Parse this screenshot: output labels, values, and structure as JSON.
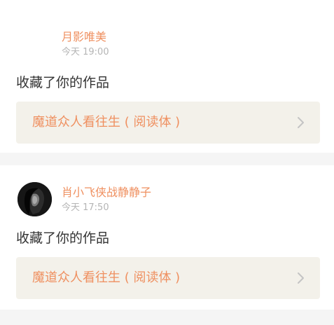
{
  "notifications": [
    {
      "username": "月影唯美",
      "time": "今天 19:00",
      "action": "收藏了你的作品",
      "work_title": "魔道众人看往生 ( 阅读体 )"
    },
    {
      "username": "肖小飞侠战静静子",
      "time": "今天 17:50",
      "action": "收藏了你的作品",
      "work_title": "魔道众人看往生 ( 阅读体 )"
    }
  ],
  "icons": {
    "chevron": "chevron-right-icon"
  },
  "colors": {
    "accent": "#e8648c",
    "username": "#ef9060",
    "card_background": "#f3f1ea",
    "separator": "#f5f5f5"
  }
}
